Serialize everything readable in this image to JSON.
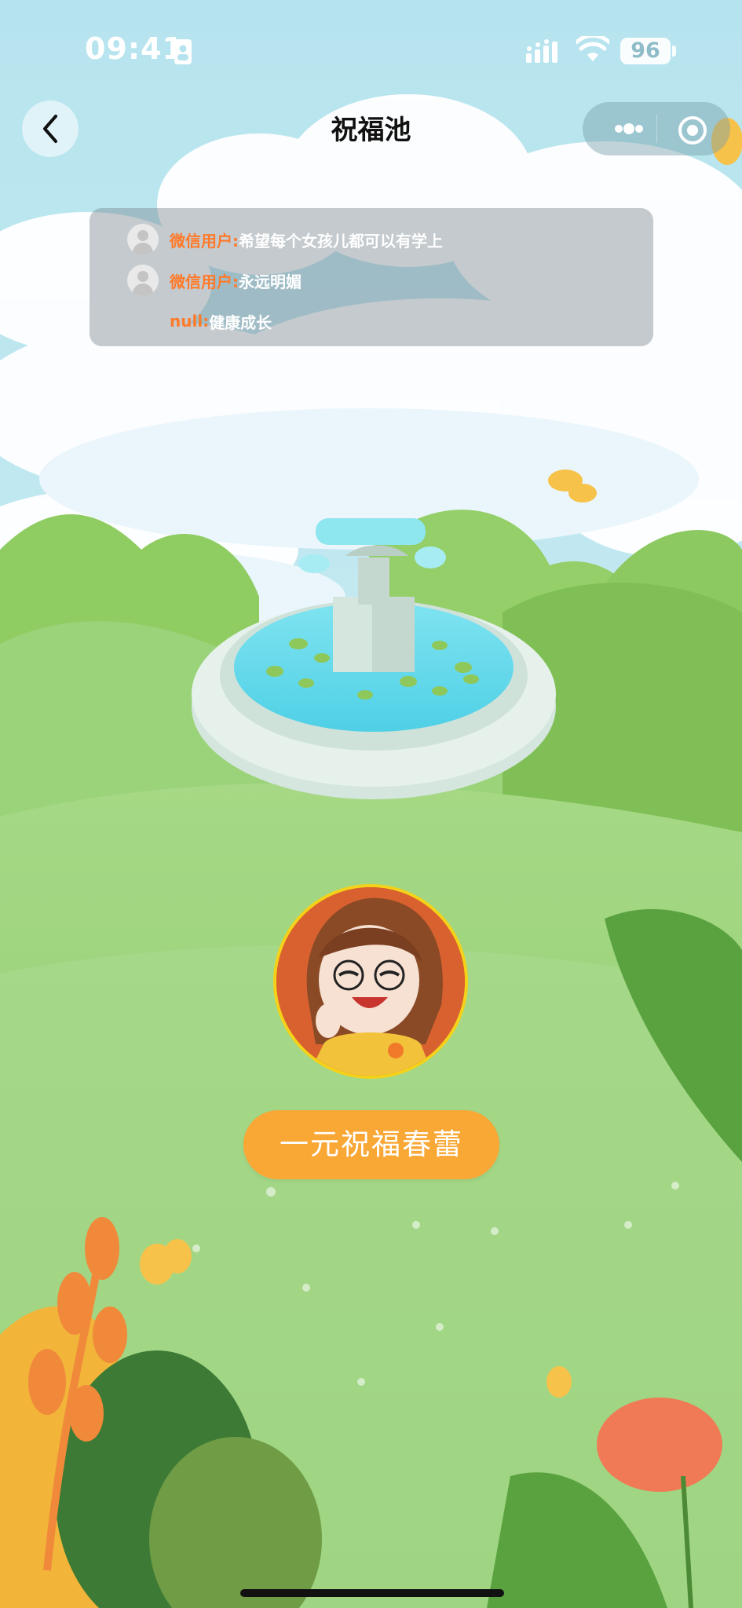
{
  "status_bar": {
    "time": "09:41",
    "battery": "96"
  },
  "nav": {
    "title": "祝福池"
  },
  "wishes": [
    {
      "user": "微信用户:",
      "text": "希望每个女孩儿都可以有学上",
      "has_avatar": true
    },
    {
      "user": "微信用户:",
      "text": "永远明媚",
      "has_avatar": true
    },
    {
      "user": "null:",
      "text": "健康成长",
      "has_avatar": false
    }
  ],
  "bless_button": {
    "label": "一元祝福春蕾"
  },
  "colors": {
    "accent_orange": "#f9a735",
    "username_orange": "#ff7a2a",
    "sky": "#bfe6f0",
    "grass": "#8fce6a"
  }
}
